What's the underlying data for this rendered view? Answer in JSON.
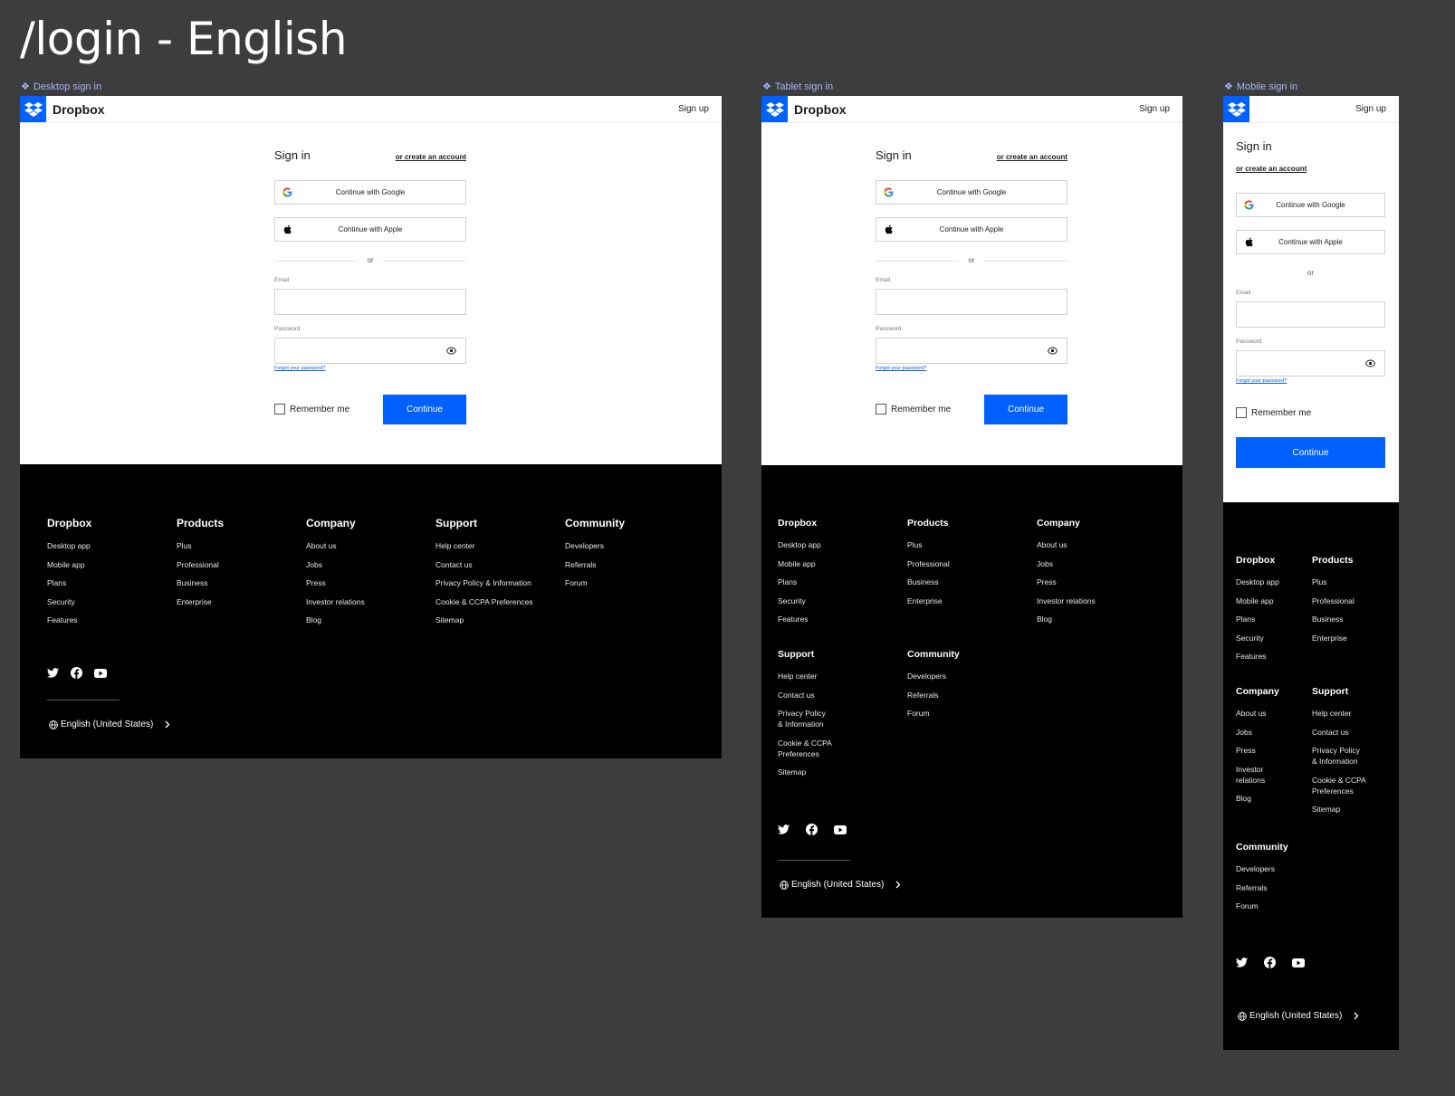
{
  "page_title": "/login - English",
  "brand": "Dropbox",
  "colors": {
    "background": "#3d3d3d",
    "accent": "#0061fe",
    "footer": "#000000",
    "label": "#a6b4ff"
  },
  "frames": {
    "desktop": {
      "label": "Desktop sign in"
    },
    "tablet": {
      "label": "Tablet sign in"
    },
    "mobile": {
      "label": "Mobile sign in"
    }
  },
  "header": {
    "signup": "Sign up"
  },
  "form": {
    "title": "Sign in",
    "create_account": "or create an account",
    "google": "Continue with Google",
    "apple": "Continue with Apple",
    "or": "or",
    "email_label": "Email",
    "email_value": "",
    "password_label": "Password",
    "password_value": "",
    "forgot": "Forgot your password?",
    "remember": "Remember me",
    "continue": "Continue"
  },
  "footer": {
    "dropbox": {
      "title": "Dropbox",
      "items": [
        "Desktop app",
        "Mobile app",
        "Plans",
        "Security",
        "Features"
      ]
    },
    "products": {
      "title": "Products",
      "items": [
        "Plus",
        "Professional",
        "Business",
        "Enterprise"
      ]
    },
    "company": {
      "title": "Company",
      "items": [
        "About us",
        "Jobs",
        "Press",
        "Investor relations",
        "Blog"
      ]
    },
    "support": {
      "title": "Support",
      "items": [
        "Help center",
        "Contact us",
        "Privacy Policy & Information",
        "Cookie & CCPA Preferences",
        "Sitemap"
      ]
    },
    "community": {
      "title": "Community",
      "items": [
        "Developers",
        "Referrals",
        "Forum"
      ]
    },
    "split": {
      "privacy_1": "Privacy Policy",
      "privacy_2": "& Information",
      "cookie_1": "Cookie & CCPA",
      "cookie_2": "Preferences",
      "investor_1": "Investor",
      "investor_2": "relations"
    },
    "social_icons": [
      "twitter-icon",
      "facebook-icon",
      "youtube-icon"
    ],
    "language": "English (United States)"
  }
}
